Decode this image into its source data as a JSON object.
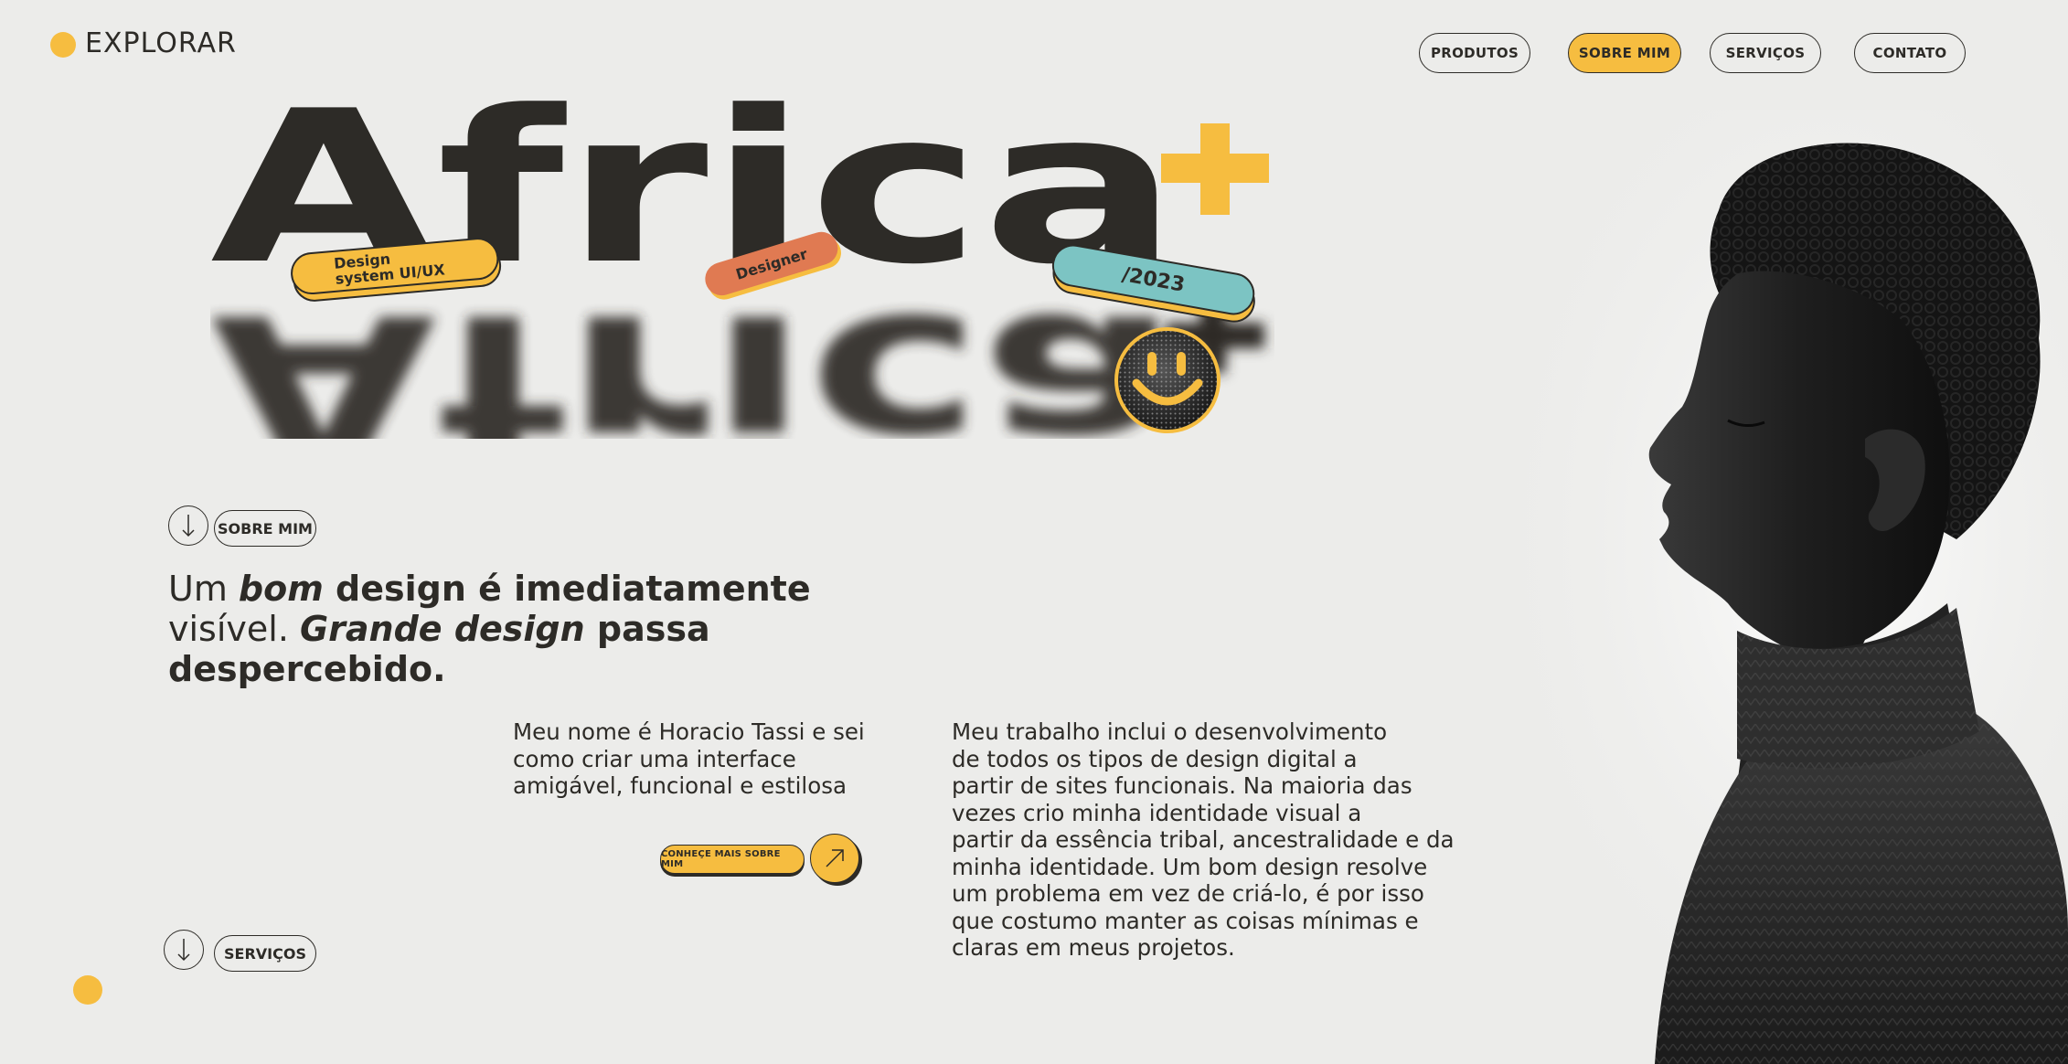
{
  "logo": {
    "text": "EXPLORAR",
    "icon": "circle-logo-icon"
  },
  "nav": [
    {
      "label": "PRODUTOS",
      "active": false
    },
    {
      "label": "SOBRE MIM",
      "active": true
    },
    {
      "label": "SERVIÇOS",
      "active": false
    },
    {
      "label": "CONTATO",
      "active": false
    }
  ],
  "hero": {
    "word": "Africa",
    "plus": "+",
    "stickers": {
      "design_system": "Design system UI/UX",
      "designer": "Designer",
      "year": "/2023"
    },
    "smiley_icon": "smiley-face-icon"
  },
  "about_section": {
    "label": "SOBRE MIM",
    "icon": "arrow-down-icon"
  },
  "headline": {
    "part1": "Um ",
    "part2": "bom",
    "part3": " design é imediatamente",
    "part4": "visível. ",
    "part5": "Grande design",
    "part6": " passa",
    "part7": "despercebido."
  },
  "intro": {
    "lines": [
      "Meu nome é Horacio Tassi e sei",
      "como criar uma interface",
      "amigável, funcional e estilosa"
    ]
  },
  "work": {
    "lines": [
      "Meu trabalho inclui o desenvolvimento",
      "de todos os tipos de design digital a",
      "partir de sites funcionais. Na maioria das",
      "vezes crio minha identidade visual a",
      "partir da essência tribal, ancestralidade e da",
      "minha identidade. Um bom design resolve",
      "um problema em vez de criá-lo, é por isso",
      "que costumo manter as coisas mínimas e",
      "claras em meus projetos."
    ]
  },
  "cta": {
    "label": "CONHEÇE MAIS SOBRE MIM",
    "icon": "arrow-up-right-icon"
  },
  "services_section": {
    "label": "SERVIÇOS",
    "icon": "arrow-down-icon"
  },
  "colors": {
    "accent": "#f6bd40",
    "dark": "#2d2b27",
    "background": "#ececea",
    "coral": "#e07a52",
    "teal": "#7cc4c3"
  }
}
